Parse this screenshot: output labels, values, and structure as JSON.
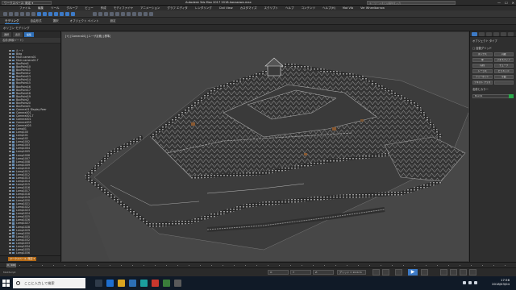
{
  "titlebar": {
    "workspace": "ワークスペース: 既定 ▾",
    "title": "Autodesk 3ds Max 2017    2018-kanazawa.max",
    "search_placeholder": "キーワードまたは語句を入力",
    "min": "—",
    "max": "☐",
    "close": "✕"
  },
  "menus": [
    "ファイル",
    "編集",
    "ツール",
    "グループ",
    "ビュー",
    "作成",
    "モディファイヤ",
    "アニメーション",
    "グラフ エディタ",
    "レンダリング",
    "Civil View",
    "カスタマイズ",
    "スクリプト",
    "ヘルプ",
    "コンテンツ",
    "ヘルプ(H)",
    "Mat Vlb",
    "Ver Wheelbarrow"
  ],
  "ribbon": {
    "tabs": [
      "モデリング",
      "自由形式",
      "選択",
      "オブジェクト ペイント",
      "設定"
    ],
    "active_index": 0,
    "sub_label": "ポリゴン モデリング"
  },
  "explorer": {
    "tabs": [
      "選択",
      "表示",
      "編集"
    ],
    "header": "名前(昇順ソート)",
    "items": [
      "ルート",
      "Bldg",
      "Main camera01",
      "Main camera01.T",
      "BoxPoint1",
      "BoxPoint10",
      "BoxPoint11",
      "BoxPoint12",
      "BoxPoint13",
      "BoxPoint14",
      "BoxPoint15",
      "BoxPoint16",
      "BoxPoint17",
      "BoxPoint18",
      "BoxPoint19",
      "BoxPoint2",
      "BoxPoint20",
      "BoxPoint21",
      "Camera01 Display Rear",
      "Camera001",
      "Camera001.T",
      "Camera001",
      "Camera005",
      "Camera005",
      "Lamp01",
      "Lamp100",
      "Lamp101",
      "Lamp102",
      "Lamp1002",
      "Lamp1003",
      "Lamp1004",
      "Lamp1005",
      "Lamp1006",
      "Lamp1007",
      "Lamp1008",
      "Lamp1009",
      "Lamp1010",
      "Lamp1011",
      "Lamp1012",
      "Lamp1013",
      "Lamp1014",
      "Lamp1015",
      "Lamp1016",
      "Lamp1017",
      "Lamp1018",
      "Lamp1019",
      "Lamp1020",
      "Lamp1021",
      "Lamp1022",
      "Lamp1023",
      "Lamp1024",
      "Lamp1025",
      "Lamp1026",
      "Lamp1027",
      "Lamp1028",
      "Lamp1029",
      "Lamp1030",
      "Lamp1031",
      "Lamp1032",
      "Lamp1033",
      "Lamp1034",
      "Lamp1035",
      "Lamp1036"
    ],
    "footer_label": "ワークスペース: 既定 ▾"
  },
  "viewport": {
    "label": "[+] [Camera01] [ユーザ定義] [標準]"
  },
  "command_panel": {
    "section_title": "オブジェクト タイプ",
    "autogrid": "□ 自動グリッド",
    "buttons": [
      "ボックス",
      "円錐",
      "球",
      "ジオスフィア",
      "円柱",
      "チューブ",
      "トーラス",
      "ピラミッド",
      "ティーポット",
      "平面",
      "テキスト プラス",
      ""
    ],
    "name_section": "名前とカラー",
    "name_value": "Box01",
    "accent": "#2aa84a"
  },
  "timeline": {
    "frame": "0 / 100"
  },
  "statusbar": {
    "script_label": "MAXScript",
    "x": "X: ",
    "y": "Y: ",
    "z": "Z: ",
    "grid": "グリッド = 10.0cm",
    "play_icon": "▶"
  },
  "taskbar": {
    "search_placeholder": "ここに入力して検索",
    "time": "17:56",
    "date": "2018/03/04"
  }
}
